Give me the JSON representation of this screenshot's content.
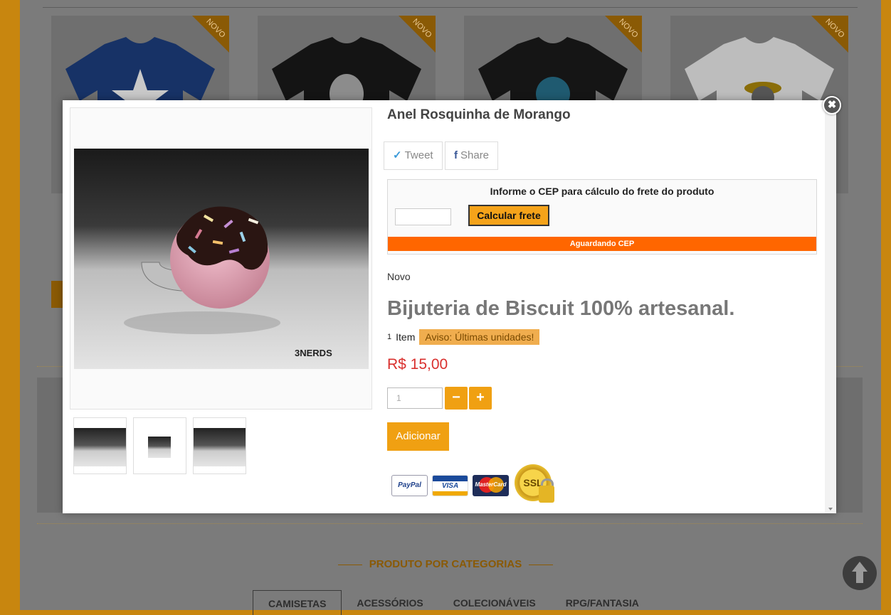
{
  "background": {
    "product_badge": "NOVO",
    "section_title": "PRODUTO POR CATEGORIAS",
    "category_tabs": [
      "CAMISETAS",
      "ACESSÓRIOS",
      "COLECIONÁVEIS",
      "RPG/FANTASIA"
    ],
    "shirt_colors": [
      "#1f3d82",
      "#1a1a1a",
      "#1c1c1c",
      "#f2f2f2"
    ]
  },
  "modal": {
    "close_symbol": "✖",
    "product_name": "Anel Rosquinha de Morango",
    "share": {
      "tweet_icon": "twitter-bird-icon",
      "tweet_label": "Tweet",
      "share_icon": "facebook-f-icon",
      "share_label": "Share"
    },
    "freight": {
      "title": "Informe o CEP para cálculo do frete do produto",
      "cep_value": "",
      "button_label": "Calcular frete",
      "status": "Aguardando CEP"
    },
    "condition": "Novo",
    "short_description": "Bijuteria de Biscuit 100% artesanal.",
    "stock_count": "1",
    "stock_unit": "Item",
    "stock_warning": "Aviso: Últimas unidades!",
    "price": "R$ 15,00",
    "quantity": "1",
    "minus_symbol": "−",
    "plus_symbol": "+",
    "add_button": "Adicionar",
    "payment_methods": {
      "paypal": "PayPal",
      "visa": "VISA",
      "mastercard": "MasterCard",
      "ssl": "SSL"
    },
    "image_logo_text": "3NERDS"
  },
  "colors": {
    "accent_orange": "#f0a012",
    "status_bar": "#ff6600",
    "price_red": "#d9302e",
    "page_gold": "#c8860f"
  }
}
